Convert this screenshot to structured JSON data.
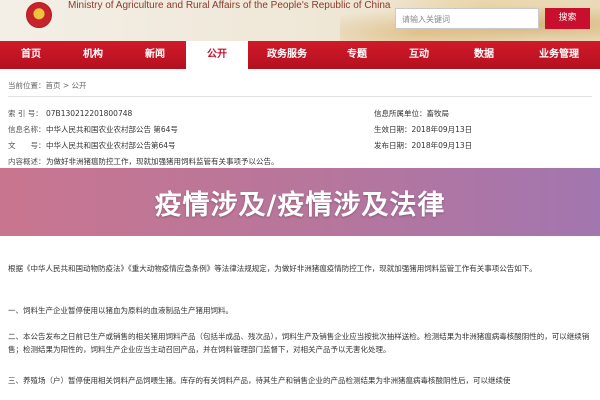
{
  "header": {
    "site_title": "Ministry of Agriculture and Rural Affairs of the People's Republic of China",
    "search_placeholder": "请输入关键词",
    "search_button": "搜索"
  },
  "nav": {
    "items": [
      "首页",
      "机构",
      "新闻",
      "公开",
      "政务服务",
      "专题",
      "互动",
      "数据",
      "业务管理"
    ],
    "active_index": 3
  },
  "breadcrumb": "当前位置：首页 > 公开",
  "meta": {
    "left": [
      {
        "k": "索 引 号：",
        "v": "07B130212201800748"
      },
      {
        "k": "信息名称：",
        "v": "中华人民共和国农业农村部公告 第64号"
      },
      {
        "k": "文　　号：",
        "v": "中华人民共和国农业农村部公告第64号"
      },
      {
        "k": "内容概述：",
        "v": "为做好非洲猪瘟防控工作，现就加强猪用饲料监管有关事项予以公告。"
      }
    ],
    "right": [
      {
        "k": "信息所属单位：",
        "v": "畜牧局"
      },
      {
        "k": "生效日期：",
        "v": "2018年09月13日"
      },
      {
        "k": "发布日期：",
        "v": "2018年09月13日"
      }
    ]
  },
  "overlay_title": "疫情涉及/疫情涉及法律",
  "body": {
    "intro": "根据《中华人民共和国动物防疫法》《重大动物疫情应急条例》等法律法规规定，为做好非洲猪瘟疫情防控工作，现就加强猪用饲料监管工作有关事项公告如下。",
    "item1": "一、饲料生产企业暂停使用以猪血为原料的血液制品生产猪用饲料。",
    "item2": "二、本公告发布之日前已生产或销售的相关猪用饲料产品（包括半成品、残次品），饲料生产及销售企业应当按批次抽样送检。检测结果为非洲猪瘟病毒核酸阴性的，可以继续销售；检测结果为阳性的，饲料生产企业应当主动召回产品，并在饲料管理部门监督下，对相关产品予以无害化处理。",
    "item3": "三、养殖场（户）暂停使用相关饲料产品饲喂生猪。库存的有关饲料产品，待其生产和销售企业的产品检测结果为非洲猪瘟病毒核酸阴性后，可以继续使"
  },
  "colors": {
    "nav_red": "#c8102e",
    "overlay": "#b46a96"
  }
}
